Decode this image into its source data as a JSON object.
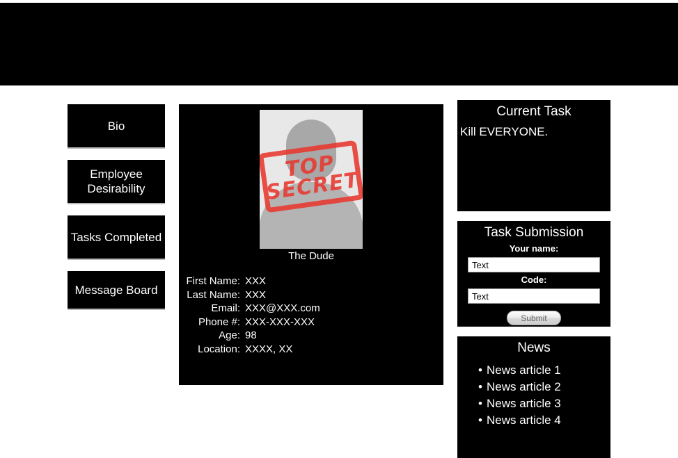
{
  "header": {
    "banner_label": "",
    "background_color": "#000000"
  },
  "sidebar": {
    "items": [
      {
        "label": "Bio"
      },
      {
        "label": "Employee\nDesirability"
      },
      {
        "label": "Tasks\nCompleted"
      },
      {
        "label": "Message Board"
      }
    ]
  },
  "profile": {
    "photo": {
      "alt": "silhouette-avatar",
      "stamp_line1": "TOP",
      "stamp_line2": "SECRET",
      "stamp_color": "#e8382f",
      "photo_background": "#e8e8e8"
    },
    "name": "The Dude",
    "fields": [
      {
        "label": "First Name:",
        "value": "XXX"
      },
      {
        "label": "Last Name:",
        "value": "XXX"
      },
      {
        "label": "Email:",
        "value": "XXX@XXX.com"
      },
      {
        "label": "Phone #:",
        "value": "XXX-XXX-XXX"
      },
      {
        "label": "Age:",
        "value": "98"
      },
      {
        "label": "Location:",
        "value": "XXXX, XX"
      }
    ]
  },
  "current_task": {
    "title": "Current Task",
    "body": "Kill EVERYONE."
  },
  "task_submission": {
    "title": "Task Submission",
    "name_label": "Your name:",
    "name_value": "Text",
    "code_label": "Code:",
    "code_value": "Text",
    "submit_label": "Submit"
  },
  "news": {
    "title": "News",
    "items": [
      {
        "label": "News article 1"
      },
      {
        "label": "News article 2"
      },
      {
        "label": "News article 3"
      },
      {
        "label": "News article 4"
      }
    ]
  }
}
